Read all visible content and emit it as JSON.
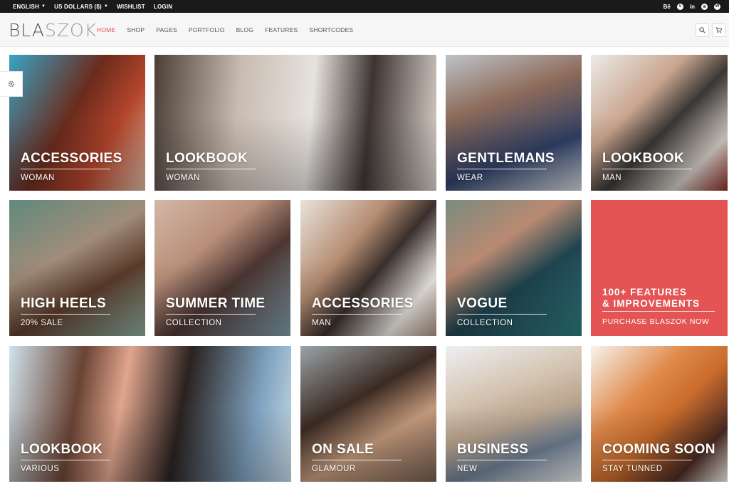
{
  "topbar": {
    "language": "ENGLISH",
    "currency": "US DOLLARS ($)",
    "wishlist": "WISHLIST",
    "login": "LOGIN",
    "social": [
      "behance-icon",
      "vimeo-icon",
      "linkedin-icon",
      "dribbble-icon",
      "wordpress-icon"
    ]
  },
  "header": {
    "logo_a": "BLA",
    "logo_b": "SZOK",
    "nav": [
      "HOME",
      "SHOP",
      "PAGES",
      "PORTFOLIO",
      "BLOG",
      "FEATURES",
      "SHORTCODES"
    ],
    "active_nav": "HOME",
    "buttons": [
      "search-icon",
      "cart-icon"
    ]
  },
  "tiles": [
    {
      "title": "ACCESSORIES",
      "subtitle": "WOMAN"
    },
    {
      "title": "LOOKBOOK",
      "subtitle": "WOMAN"
    },
    {
      "title": "GENTLEMANS",
      "subtitle": "WEAR"
    },
    {
      "title": "LOOKBOOK",
      "subtitle": "MAN"
    },
    {
      "title": "HIGH HEELS",
      "subtitle": "20% SALE"
    },
    {
      "title": "SUMMER TIME",
      "subtitle": "COLLECTION"
    },
    {
      "title": "ACCESSORIES",
      "subtitle": "MAN"
    },
    {
      "title": "VOGUE",
      "subtitle": "COLLECTION"
    },
    {
      "title": "LOOKBOOK",
      "subtitle": "VARIOUS"
    },
    {
      "title": "ON SALE",
      "subtitle": "GLAMOUR"
    },
    {
      "title": "BUSINESS",
      "subtitle": "NEW"
    },
    {
      "title": "COOMING SOON",
      "subtitle": "STAY TUNNED"
    }
  ],
  "promo": {
    "line1": "100+ FEATURES",
    "line2": "& IMPROVEMENTS",
    "cta": "PURCHASE BLASZOK NOW"
  },
  "colors": {
    "accent": "#e55454",
    "topbar": "#1a1a1a"
  }
}
